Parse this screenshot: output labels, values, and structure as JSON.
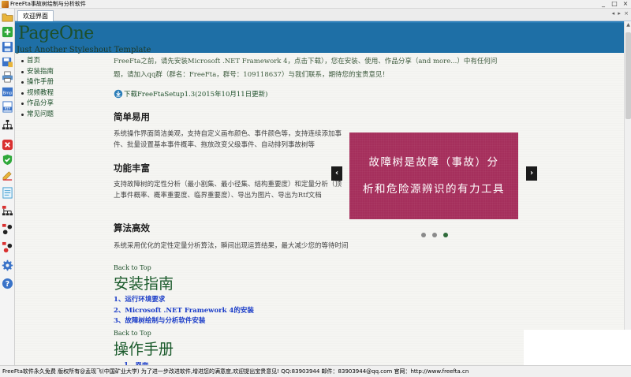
{
  "window": {
    "title": "FreeFta事故树绘制与分析软件",
    "controls": [
      "_",
      "□",
      "×"
    ]
  },
  "toolbar": {
    "tools": [
      {
        "icon": "folder-icon",
        "color": "#e8b43a"
      },
      {
        "icon": "new-plus-icon",
        "color": "#2fa83a"
      },
      {
        "icon": "save-icon",
        "color": "#3a73c8"
      },
      {
        "icon": "save-as-icon",
        "color": "#7b5ab8"
      },
      {
        "icon": "print-icon",
        "color": "#5a8fc8"
      },
      {
        "icon": "export-image-icon",
        "color": "#3a73c8"
      },
      {
        "icon": "export-rtf-icon",
        "color": "#3a73c8"
      },
      {
        "icon": "tree-icon",
        "color": "#222222"
      },
      {
        "icon": "delete-icon",
        "color": "#d93030"
      },
      {
        "icon": "check-icon",
        "color": "#2fa83a"
      },
      {
        "icon": "pencil-icon",
        "color": "#e8b43a"
      },
      {
        "icon": "report-icon",
        "color": "#3a9ad0"
      },
      {
        "icon": "fault-tree-p-icon",
        "color": "#d93030"
      },
      {
        "icon": "fault-tree-q-icon",
        "color": "#d93030"
      },
      {
        "icon": "fault-tree-r-icon",
        "color": "#d93030"
      },
      {
        "icon": "settings-icon",
        "color": "#3a73c8"
      },
      {
        "icon": "help-icon",
        "color": "#3a73c8"
      }
    ]
  },
  "tabs": [
    {
      "label": "欢迎界面",
      "active": true
    }
  ],
  "tab_nav": "◂ ▸ ×",
  "site": {
    "title": "PageOne",
    "subtitle": "Just Another Styleshout Template"
  },
  "nav": [
    "首页",
    "安装指南",
    "操作手册",
    "视频教程",
    "作品分享",
    "常见问题"
  ],
  "intro": "FreeFta之前，请先安装Microsoft .NET Framework 4，点击下载），您在安装、使用、作品分享（and more...）中有任何问题，请加入qq群（群名：FreeFta，群号：109118637）与我们联系，期待您的宝贵意见！",
  "download_link": "下载FreeFtaSetup1.3(2015年10月11日更新)",
  "sections": [
    {
      "heading": "简单易用",
      "body": "系统操作界面简洁美观，支持自定义画布颜色、事件颜色等，支持连续添加事件、批量设置基本事件概率、拖放改变父级事件、自动排列事故树等"
    },
    {
      "heading": "功能丰富",
      "body": "支持故障树的定性分析（最小割集、最小径集、结构重要度）和定量分析（顶上事件概率、概率重要度、临界重要度）、导出为图片、导出为Rtf文档"
    },
    {
      "heading": "算法高效",
      "body": "系统采用优化的定性定量分析算法，瞬间出现运算结果，最大减少您的等待时间"
    }
  ],
  "slider": {
    "lines": [
      "故障树是故障（事故）分",
      "析和危险源辨识的有力工具"
    ],
    "prev": "‹",
    "next": "›",
    "dot_count": 3,
    "active_dot": 3,
    "background": "#a52f5c"
  },
  "install": {
    "back_to_top": "Back to Top",
    "heading": "安装指南",
    "items": [
      "1、运行环境要求",
      "2、Microsoft .NET Framework 4的安装",
      "3、故障树绘制与分析软件安装"
    ]
  },
  "manual": {
    "back_to_top": "Back to Top",
    "heading": "操作手册",
    "first_item": "1、界面"
  },
  "statusbar": "FreeFta软件永久免费 版权所有@孟现飞(中国矿业大学)  为了进一步改进软件,增进您的满意度,欢迎提出宝贵意见! QQ:83903944   邮件：83903944@qq.com   官网：http://www.freefta.cn"
}
